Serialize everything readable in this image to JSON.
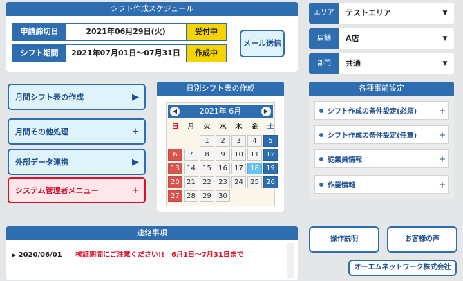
{
  "schedule": {
    "title": "シフト作成スケジュール",
    "deadline_label": "申請締切日",
    "deadline_value": "2021年06月29日(火)",
    "deadline_status": "受付中",
    "period_label": "シフト期間",
    "period_value": "2021年07月01日〜07月31日",
    "period_status": "作成中",
    "mail_button": "メール送信"
  },
  "selectors": [
    {
      "label": "エリア",
      "value": "テストエリア"
    },
    {
      "label": "店舗",
      "value": "A店"
    },
    {
      "label": "部門",
      "value": "共通"
    }
  ],
  "menu": [
    {
      "label": "月間シフト表の作成",
      "mark": "▶"
    },
    {
      "label": "月間その他処理",
      "mark": "+"
    },
    {
      "label": "外部データ連携",
      "mark": "▶"
    },
    {
      "label": "システム管理者メニュー",
      "mark": "+"
    }
  ],
  "calendar": {
    "title": "日別シフト表の作成",
    "month_label": "2021年 6月",
    "prev": "◀",
    "next": "▶",
    "weekdays": [
      "日",
      "月",
      "火",
      "水",
      "木",
      "金",
      "土"
    ],
    "days": [
      [
        "",
        "",
        "1",
        "2",
        "3",
        "4",
        "5"
      ],
      [
        "6",
        "7",
        "8",
        "9",
        "10",
        "11",
        "12"
      ],
      [
        "13",
        "14",
        "15",
        "16",
        "17",
        "18",
        "19"
      ],
      [
        "20",
        "21",
        "22",
        "23",
        "24",
        "25",
        "26"
      ],
      [
        "27",
        "28",
        "29",
        "30",
        "",
        "",
        ""
      ]
    ],
    "today": "18"
  },
  "settings": {
    "title": "各種事前設定",
    "items": [
      {
        "label": "シフト作成の条件設定(必須)",
        "mark": "+"
      },
      {
        "label": "シフト作成の条件設定(任意)",
        "mark": "+"
      },
      {
        "label": "従業員情報",
        "mark": "+"
      },
      {
        "label": "作業情報",
        "mark": "+"
      }
    ]
  },
  "notices": {
    "title": "連絡事項",
    "items": [
      {
        "marker": "▶",
        "date": "2020/06/01",
        "text": "検証期間にご注意ください!!　6月1日〜7月31日まで"
      }
    ]
  },
  "buttons": {
    "manual": "操作説明",
    "feedback": "お客様の声",
    "company": "オーエムネットワーク株式会社"
  },
  "colors": {
    "primary": "#2e6db0",
    "accent_yellow": "#f5d400",
    "alert_red": "#d9122a",
    "today_blue": "#66c2f0"
  }
}
